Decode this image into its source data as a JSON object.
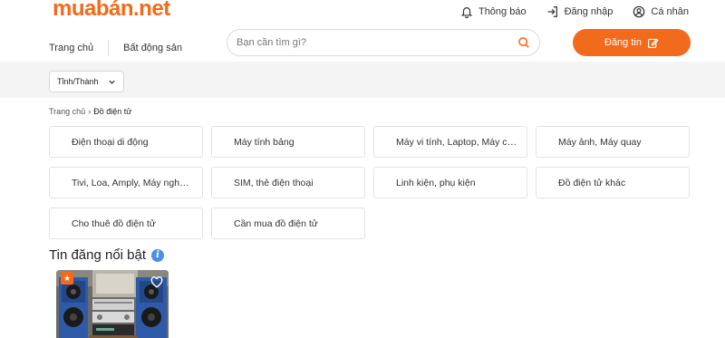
{
  "header": {
    "logo_brand": "muabán",
    "logo_tld": ".net",
    "top_links": [
      {
        "label": "Thông báo",
        "icon": "bell-icon"
      },
      {
        "label": "Đăng nhập",
        "icon": "login-icon"
      },
      {
        "label": "Cá nhân",
        "icon": "user-icon"
      }
    ],
    "nav": [
      "Trang chủ",
      "Bất động sản"
    ],
    "search_placeholder": "Bạn cần tìm gì?",
    "post_button": "Đăng tin"
  },
  "filter": {
    "province_label": "Tỉnh/Thành"
  },
  "breadcrumb": {
    "home": "Trang chủ",
    "separator": "›",
    "current": "Đồ điện tử"
  },
  "categories": [
    "Điện thoại di động",
    "Máy tính bảng",
    "Máy vi tính, Laptop, Máy chủ",
    "Máy ảnh, Máy quay",
    "Tivi, Loa, Amply, Máy nghe nhạc",
    "SIM, thẻ điện thoại",
    "Linh kiện, phụ kiện",
    "Đồ điện tử khác",
    "Cho thuê đồ điện tử",
    "Cần mua đồ điện tử"
  ],
  "featured": {
    "title": "Tin đăng nổi bật",
    "info_icon": "i"
  },
  "colors": {
    "accent": "#f26a1b",
    "info": "#4a90e2",
    "filter_bg": "#f4f4f4"
  }
}
